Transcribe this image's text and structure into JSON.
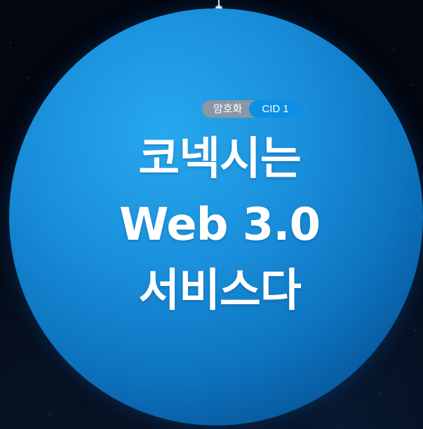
{
  "badges": {
    "category": "암호화",
    "id": "CID 1"
  },
  "headline": {
    "line1": "코넥시는",
    "line2": "Web 3.0",
    "line3": "서비스다"
  },
  "colors": {
    "background": "#02060f",
    "sphere": "#1a8fdb",
    "badge_gray": "#8a97a6",
    "badge_blue": "#0d8fe6",
    "text": "#ffffff"
  }
}
